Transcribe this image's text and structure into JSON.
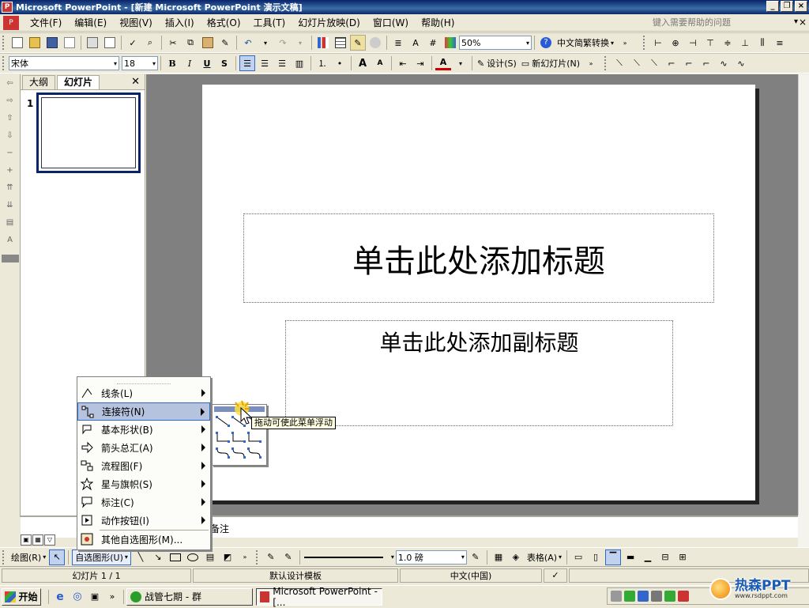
{
  "window": {
    "title": "Microsoft PowerPoint - [新建 Microsoft PowerPoint 演示文稿]",
    "help_placeholder": "键入需要帮助的问题"
  },
  "menu": [
    "文件(F)",
    "编辑(E)",
    "视图(V)",
    "插入(I)",
    "格式(O)",
    "工具(T)",
    "幻灯片放映(D)",
    "窗口(W)",
    "帮助(H)"
  ],
  "standard_toolbar": {
    "zoom": "50%",
    "convert_label": "中文简繁转换"
  },
  "format_toolbar": {
    "font": "宋体",
    "size": "18",
    "bold": "B",
    "italic": "I",
    "underline": "U",
    "shadow": "S",
    "design_label": "设计(S)",
    "new_slide_label": "新幻灯片(N)"
  },
  "nav_pane": {
    "tabs": [
      "大纲",
      "幻灯片"
    ],
    "active_tab": "幻灯片",
    "slide_number": "1"
  },
  "slide": {
    "title_placeholder": "单击此处添加标题",
    "subtitle_placeholder": "单击此处添加副标题"
  },
  "notes": {
    "label": "备注"
  },
  "draw_toolbar": {
    "draw_label": "绘图(R)",
    "autoshape_label": "自选图形(U)",
    "line_width": "1.0 磅",
    "table_label": "表格(A)"
  },
  "autoshape_menu": {
    "items": [
      {
        "label": "线条(L)",
        "icon": "lines-icon",
        "has_submenu": true
      },
      {
        "label": "连接符(N)",
        "icon": "connector-icon",
        "has_submenu": true,
        "selected": true
      },
      {
        "label": "基本形状(B)",
        "icon": "basic-shapes-icon",
        "has_submenu": true
      },
      {
        "label": "箭头总汇(A)",
        "icon": "block-arrows-icon",
        "has_submenu": true
      },
      {
        "label": "流程图(F)",
        "icon": "flowchart-icon",
        "has_submenu": true
      },
      {
        "label": "星与旗帜(S)",
        "icon": "stars-banners-icon",
        "has_submenu": true
      },
      {
        "label": "标注(C)",
        "icon": "callouts-icon",
        "has_submenu": true
      },
      {
        "label": "动作按钮(I)",
        "icon": "action-buttons-icon",
        "has_submenu": true
      },
      {
        "label": "其他自选图形(M)...",
        "icon": "more-autoshapes-icon",
        "has_submenu": false
      }
    ],
    "tooltip": "拖动可使此菜单浮动"
  },
  "status_bar": {
    "slide_info": "幻灯片 1 / 1",
    "template": "默认设计模板",
    "language": "中文(中国)"
  },
  "taskbar": {
    "start_label": "开始",
    "tasks": [
      {
        "label": "战管七期 - 群",
        "active": false
      },
      {
        "label": "Microsoft PowerPoint - [...",
        "active": true
      }
    ]
  },
  "watermark": {
    "text": "热森PPT",
    "url": "www.rsdppt.com"
  },
  "colors": {
    "title_bar": "#0A246A",
    "canvas_bg": "#808080",
    "menu_selection": "#b6c3de",
    "thumb_border": "#0A246A"
  }
}
